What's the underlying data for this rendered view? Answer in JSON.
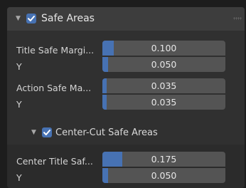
{
  "panel": {
    "title": "Safe Areas",
    "enabled": true,
    "rows": [
      {
        "label": "Title Safe Margi...",
        "value": "0.100",
        "fraction": 0.1
      },
      {
        "label": "Y",
        "value": "0.050",
        "fraction": 0.05
      },
      {
        "label": "Action Safe Ma...",
        "value": "0.035",
        "fraction": 0.035
      },
      {
        "label": "Y",
        "value": "0.035",
        "fraction": 0.035
      }
    ]
  },
  "subpanel": {
    "title": "Center-Cut Safe Areas",
    "enabled": true,
    "rows": [
      {
        "label": "Center Title Saf...",
        "value": "0.175",
        "fraction": 0.175
      },
      {
        "label": "Y",
        "value": "0.050",
        "fraction": 0.05
      }
    ]
  },
  "colors": {
    "accent": "#4772b3",
    "field": "#545454",
    "panel": "#303030"
  },
  "icons": {
    "collapse": "triangle-down-icon",
    "check": "checkmark-icon",
    "drag": "drag-grip-icon"
  }
}
